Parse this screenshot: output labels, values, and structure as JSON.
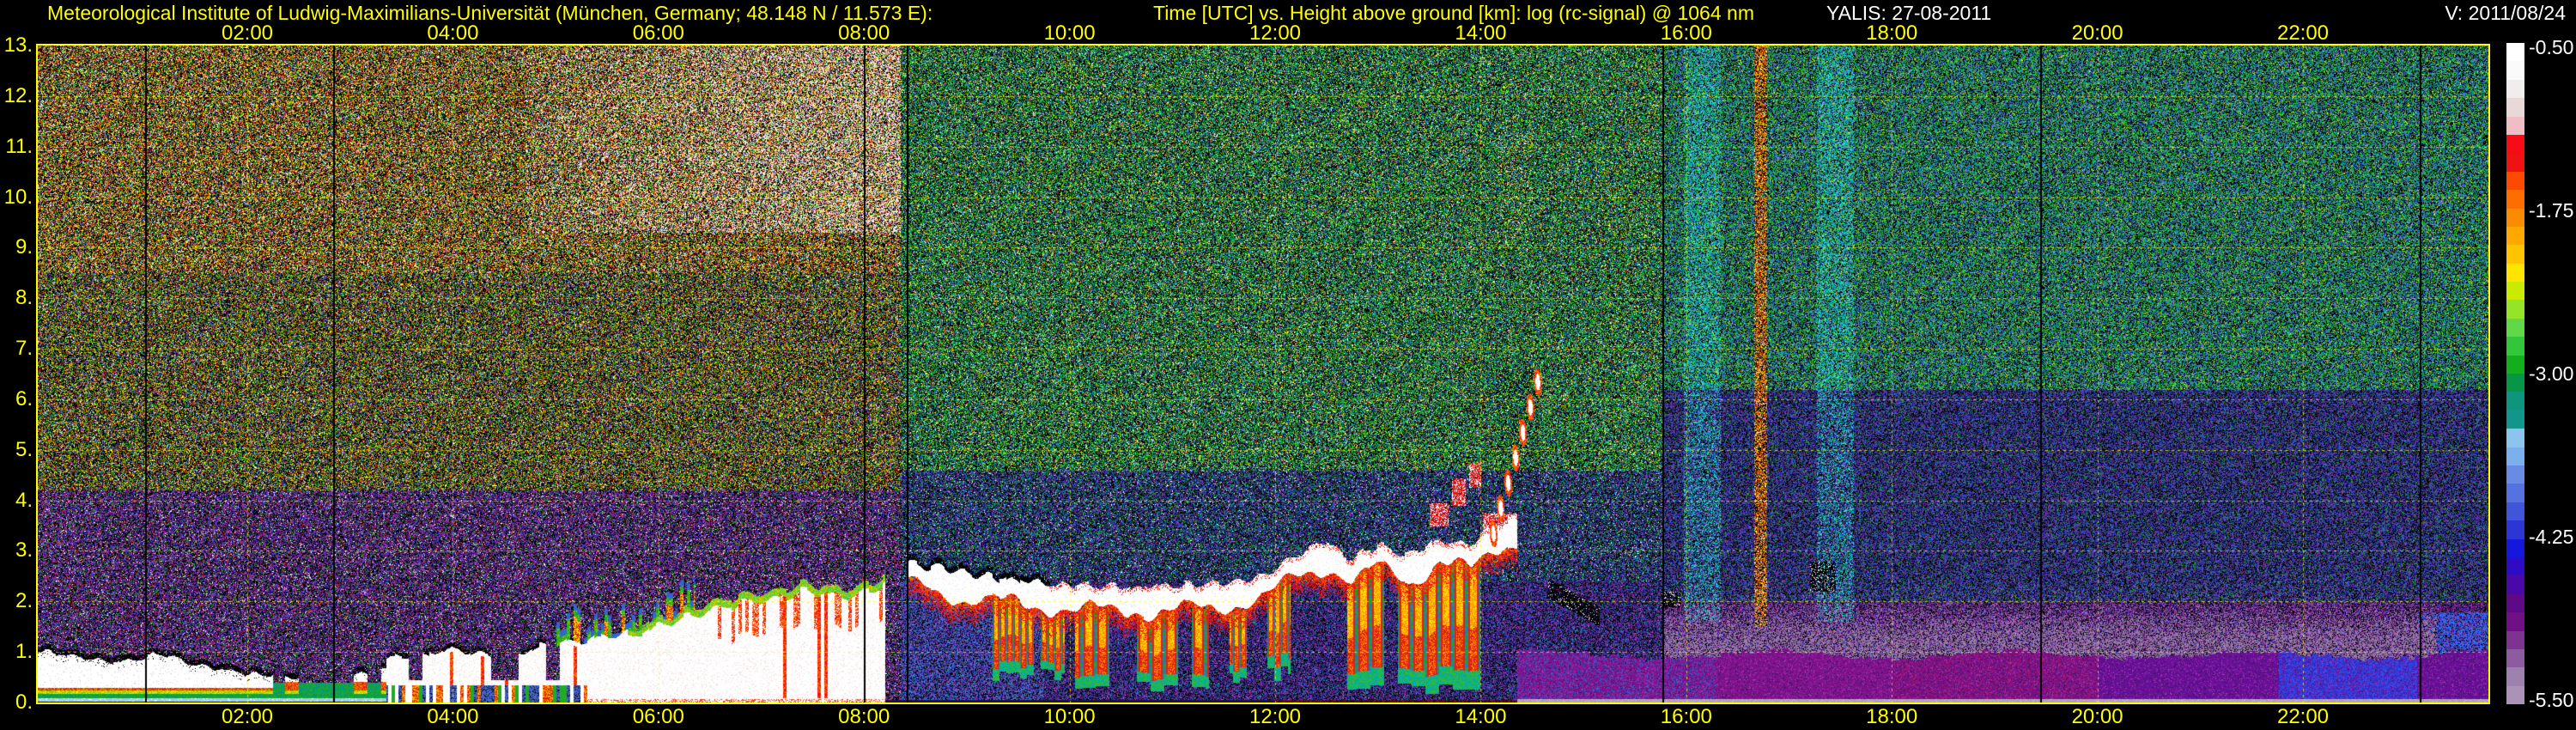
{
  "header": {
    "institute": "Meteorological Institute of Ludwig-Maximilians-Universität (München, Germany; 48.148 N / 11.573 E):",
    "plot_title": "Time [UTC] vs. Height above ground [km]: log (rc-signal) @ 1064 nm",
    "system_date": "YALIS: 27-08-2011",
    "version": "V: 2011/08/24"
  },
  "colors": {
    "background": "#000000",
    "axis_text": "#ffff00",
    "info_text": "#ffffff",
    "grid": "#ffff00",
    "plot_border": "#ffff00"
  },
  "chart_data": {
    "type": "heatmap",
    "title": "Time [UTC] vs. Height above ground [km]: log (rc-signal) @ 1064 nm",
    "xlabel": "Time [UTC]",
    "ylabel": "Height above ground [km]",
    "value_label": "log (rc-signal) @ 1064 nm",
    "x_range_hours": [
      0,
      24
    ],
    "y_range_km": [
      0,
      13
    ],
    "time_ticks": [
      {
        "label": "02:00",
        "hour": 2
      },
      {
        "label": "04:00",
        "hour": 4
      },
      {
        "label": "06:00",
        "hour": 6
      },
      {
        "label": "08:00",
        "hour": 8
      },
      {
        "label": "10:00",
        "hour": 10
      },
      {
        "label": "12:00",
        "hour": 12
      },
      {
        "label": "14:00",
        "hour": 14
      },
      {
        "label": "16:00",
        "hour": 16
      },
      {
        "label": "18:00",
        "hour": 18
      },
      {
        "label": "20:00",
        "hour": 20
      },
      {
        "label": "22:00",
        "hour": 22
      }
    ],
    "height_ticks": [
      "13.",
      "12.",
      "11.",
      "10.",
      "9.",
      "8.",
      "7.",
      "6.",
      "5.",
      "4.",
      "3.",
      "2.",
      "1.",
      "0."
    ],
    "gridlines": {
      "horizontal_every_km": 1,
      "vertical_every_hours": 2,
      "style": "dashed yellow"
    },
    "colorbar": {
      "labels": [
        "-0.50",
        "-1.75",
        "-3.00",
        "-4.25",
        "-5.50"
      ],
      "value_top": -0.5,
      "value_bottom": -5.5,
      "stops": [
        "#ffffff",
        "#fafafa",
        "#f2eded",
        "#e8d8d8",
        "#eebec4",
        "#f60b16",
        "#ee1212",
        "#fc4a00",
        "#fd6d00",
        "#fb8b00",
        "#ffa900",
        "#ffc400",
        "#ffe400",
        "#ccea00",
        "#96e42a",
        "#60d848",
        "#34c63a",
        "#12ae1c",
        "#089546",
        "#0e957e",
        "#12968c",
        "#8cc4ee",
        "#7cb0ec",
        "#688ce6",
        "#5472e0",
        "#3f55da",
        "#2b36d4",
        "#1518dc",
        "#2e0cc4",
        "#4a08a8",
        "#5e0a86",
        "#6f1184",
        "#7d3390",
        "#8d5c9e",
        "#9d82ae",
        "#ab93b8"
      ]
    },
    "features": {
      "zone_boundaries_h": [
        8.35,
        15.77
      ],
      "night_layer_top_km": [
        [
          0,
          1.02
        ],
        [
          0.5,
          0.86
        ],
        [
          0.8,
          0.8
        ],
        [
          1.15,
          0.97
        ],
        [
          1.5,
          0.76
        ],
        [
          2.0,
          0.58
        ],
        [
          2.6,
          0.5
        ],
        [
          3.0,
          0.54
        ],
        [
          3.35,
          0.66
        ]
      ],
      "morning_deck_top_km": [
        [
          3.35,
          0.85
        ],
        [
          4.0,
          1.05
        ],
        [
          4.5,
          0.95
        ],
        [
          5.0,
          1.15
        ],
        [
          5.6,
          1.35
        ],
        [
          6.2,
          1.75
        ],
        [
          6.9,
          2.1
        ],
        [
          7.4,
          2.3
        ],
        [
          7.9,
          2.2
        ],
        [
          8.2,
          2.45
        ]
      ],
      "deck_end_h": 8.2,
      "cloud_band_top_km": [
        [
          8.42,
          2.8
        ],
        [
          9.0,
          2.55
        ],
        [
          9.6,
          2.4
        ],
        [
          10.3,
          2.3
        ],
        [
          10.9,
          2.3
        ],
        [
          11.4,
          2.35
        ],
        [
          11.9,
          2.55
        ],
        [
          12.2,
          2.95
        ],
        [
          12.5,
          3.2
        ],
        [
          12.75,
          2.85
        ],
        [
          13.0,
          3.15
        ],
        [
          13.3,
          2.9
        ],
        [
          13.6,
          3.25
        ],
        [
          13.9,
          3.1
        ],
        [
          14.15,
          3.55
        ],
        [
          14.35,
          3.7
        ]
      ],
      "virga_intervals_h": [
        [
          9.25,
          9.95
        ],
        [
          10.05,
          11.35
        ],
        [
          11.55,
          12.15
        ],
        [
          12.7,
          14.1
        ]
      ],
      "plume": {
        "t_start": 14.1,
        "t_end": 14.6,
        "h_start": 3.35,
        "h_end": 6.5
      },
      "high_cloud_fragments": [
        [
          13.5,
          13.68,
          3.5,
          3.95
        ],
        [
          13.72,
          13.85,
          3.9,
          4.45
        ],
        [
          13.88,
          14.0,
          4.25,
          4.75
        ],
        [
          14.02,
          14.32,
          2.85,
          3.75
        ]
      ],
      "black_cloud_patches": [
        [
          14.65,
          15.15,
          1.85,
          2.45
        ],
        [
          15.75,
          15.95,
          1.9,
          2.2
        ],
        [
          17.2,
          17.45,
          2.2,
          2.8
        ]
      ],
      "small_clouds_night": [
        1.92,
        2.18,
        2.4,
        3.5
      ],
      "evening_blue_patch": [
        21.76,
        23.11,
        0.05,
        1.0
      ],
      "night_blue_bright": [
        23.11,
        24.0,
        0.7,
        1.8
      ],
      "mauve_haze": {
        "t": [
          15.77,
          23.3
        ],
        "h_center": 1.15,
        "h_sigma": 0.45
      },
      "gap_lines_t": [
        1.006,
        2.836,
        8.0,
        8.42,
        15.77,
        19.44,
        23.14
      ],
      "orange_column_t": 16.72,
      "cyan_columns_t": [
        16.15,
        17.45
      ]
    }
  }
}
